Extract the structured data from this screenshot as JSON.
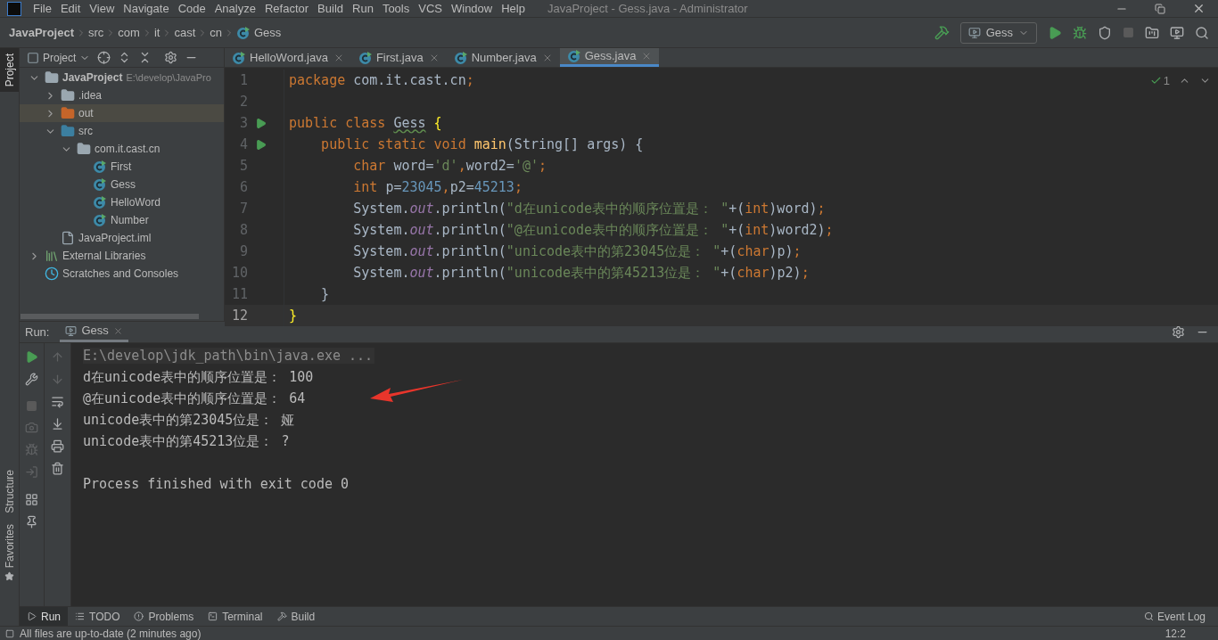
{
  "menu": [
    "File",
    "Edit",
    "View",
    "Navigate",
    "Code",
    "Analyze",
    "Refactor",
    "Build",
    "Run",
    "Tools",
    "VCS",
    "Window",
    "Help"
  ],
  "window": {
    "title": "JavaProject - Gess.java - Administrator"
  },
  "breadcrumb": [
    {
      "label": "JavaProject",
      "kind": "project"
    },
    {
      "label": "src",
      "kind": "dir"
    },
    {
      "label": "com",
      "kind": "dir"
    },
    {
      "label": "it",
      "kind": "dir"
    },
    {
      "label": "cast",
      "kind": "dir"
    },
    {
      "label": "cn",
      "kind": "dir"
    },
    {
      "label": "Gess",
      "kind": "class"
    }
  ],
  "run_config": "Gess",
  "side_tools": {
    "top": "Project",
    "structure": "Structure",
    "favorites": "Favorites"
  },
  "project_panel": {
    "title": "Project",
    "tree": [
      {
        "label": "JavaProject",
        "path": "E:\\develop\\JavaPro",
        "kind": "module",
        "expanded": true,
        "selected": false,
        "children": [
          {
            "label": ".idea",
            "kind": "folder",
            "expanded": false,
            "selected": false
          },
          {
            "label": "out",
            "kind": "output-folder",
            "expanded": false,
            "selected": true
          },
          {
            "label": "src",
            "kind": "source-folder",
            "expanded": true,
            "selected": false,
            "children": [
              {
                "label": "com.it.cast.cn",
                "kind": "package",
                "expanded": true,
                "selected": false,
                "children": [
                  {
                    "label": "First",
                    "kind": "class",
                    "selected": false
                  },
                  {
                    "label": "Gess",
                    "kind": "class",
                    "selected": false
                  },
                  {
                    "label": "HelloWord",
                    "kind": "class",
                    "selected": false
                  },
                  {
                    "label": "Number",
                    "kind": "class",
                    "selected": false
                  }
                ]
              }
            ]
          },
          {
            "label": "JavaProject.iml",
            "kind": "file",
            "selected": false
          }
        ]
      },
      {
        "label": "External Libraries",
        "kind": "libraries",
        "expanded": false,
        "selected": false
      },
      {
        "label": "Scratches and Consoles",
        "kind": "scratches",
        "selected": false
      }
    ]
  },
  "editor_tabs": [
    {
      "label": "HelloWord.java",
      "selected": false
    },
    {
      "label": "First.java",
      "selected": false
    },
    {
      "label": "Number.java",
      "selected": false
    },
    {
      "label": "Gess.java",
      "selected": true
    }
  ],
  "inspection": {
    "count": "1"
  },
  "code": [
    {
      "number": "1",
      "current": false,
      "runnable": false,
      "tokens": [
        {
          "kind": "kw",
          "text": "package"
        },
        {
          "kind": "plain",
          "text": " com.it.cast.cn"
        },
        {
          "kind": "kw",
          "text": ";"
        }
      ]
    },
    {
      "number": "2",
      "current": false,
      "runnable": false
    },
    {
      "number": "3",
      "current": false,
      "runnable": true,
      "tokens": [
        {
          "kind": "kw",
          "text": "public class "
        },
        {
          "kind": "warn",
          "text": "Gess"
        },
        {
          "kind": "brace",
          "text": " {"
        }
      ]
    },
    {
      "number": "4",
      "current": false,
      "runnable": true,
      "tokens": [
        {
          "kind": "kw",
          "text": "    public static void "
        },
        {
          "kind": "method",
          "text": "main"
        },
        {
          "kind": "plain",
          "text": "(String[] args) {"
        }
      ]
    },
    {
      "number": "5",
      "current": false,
      "runnable": false,
      "tokens": [
        {
          "kind": "kw",
          "text": "        char "
        },
        {
          "kind": "plain",
          "text": "word="
        },
        {
          "kind": "str",
          "text": "'d'"
        },
        {
          "kind": "kw",
          "text": ","
        },
        {
          "kind": "plain",
          "text": "word2="
        },
        {
          "kind": "str",
          "text": "'@'"
        },
        {
          "kind": "kw",
          "text": ";"
        }
      ]
    },
    {
      "number": "6",
      "current": false,
      "runnable": false,
      "tokens": [
        {
          "kind": "kw",
          "text": "        int "
        },
        {
          "kind": "plain",
          "text": "p="
        },
        {
          "kind": "num",
          "text": "23045"
        },
        {
          "kind": "kw",
          "text": ","
        },
        {
          "kind": "plain",
          "text": "p2="
        },
        {
          "kind": "num",
          "text": "45213"
        },
        {
          "kind": "kw",
          "text": ";"
        }
      ]
    },
    {
      "number": "7",
      "current": false,
      "runnable": false,
      "tokens": [
        {
          "kind": "plain",
          "text": "        System."
        },
        {
          "kind": "field",
          "text": "out"
        },
        {
          "kind": "plain",
          "text": ".println("
        },
        {
          "kind": "str",
          "text": "\"d在unicode表中的顺序位置是： \""
        },
        {
          "kind": "plain",
          "text": "+("
        },
        {
          "kind": "kw",
          "text": "int"
        },
        {
          "kind": "plain",
          "text": ")word)"
        },
        {
          "kind": "kw",
          "text": ";"
        }
      ]
    },
    {
      "number": "8",
      "current": false,
      "runnable": false,
      "tokens": [
        {
          "kind": "plain",
          "text": "        System."
        },
        {
          "kind": "field",
          "text": "out"
        },
        {
          "kind": "plain",
          "text": ".println("
        },
        {
          "kind": "str",
          "text": "\"@在unicode表中的顺序位置是： \""
        },
        {
          "kind": "plain",
          "text": "+("
        },
        {
          "kind": "kw",
          "text": "int"
        },
        {
          "kind": "plain",
          "text": ")word2)"
        },
        {
          "kind": "kw",
          "text": ";"
        }
      ]
    },
    {
      "number": "9",
      "current": false,
      "runnable": false,
      "tokens": [
        {
          "kind": "plain",
          "text": "        System."
        },
        {
          "kind": "field",
          "text": "out"
        },
        {
          "kind": "plain",
          "text": ".println("
        },
        {
          "kind": "str",
          "text": "\"unicode表中的第23045位是： \""
        },
        {
          "kind": "plain",
          "text": "+("
        },
        {
          "kind": "kw",
          "text": "char"
        },
        {
          "kind": "plain",
          "text": ")p)"
        },
        {
          "kind": "kw",
          "text": ";"
        }
      ]
    },
    {
      "number": "10",
      "current": false,
      "runnable": false,
      "tokens": [
        {
          "kind": "plain",
          "text": "        System."
        },
        {
          "kind": "field",
          "text": "out"
        },
        {
          "kind": "plain",
          "text": ".println("
        },
        {
          "kind": "str",
          "text": "\"unicode表中的第45213位是： \""
        },
        {
          "kind": "plain",
          "text": "+("
        },
        {
          "kind": "kw",
          "text": "char"
        },
        {
          "kind": "plain",
          "text": ")p2)"
        },
        {
          "kind": "kw",
          "text": ";"
        }
      ]
    },
    {
      "number": "11",
      "current": false,
      "runnable": false,
      "tokens": [
        {
          "kind": "plain",
          "text": "    }"
        }
      ]
    },
    {
      "number": "12",
      "current": true,
      "runnable": false,
      "tokens": [
        {
          "kind": "brace",
          "text": "}"
        }
      ]
    }
  ],
  "run_panel": {
    "label": "Run:",
    "tab": "Gess",
    "console": [
      {
        "kind": "command",
        "text": "E:\\develop\\jdk_path\\bin\\java.exe ..."
      },
      {
        "kind": "output",
        "text": "d在unicode表中的顺序位置是： 100"
      },
      {
        "kind": "output",
        "text": "@在unicode表中的顺序位置是： 64"
      },
      {
        "kind": "output",
        "text": "unicode表中的第23045位是： 娅"
      },
      {
        "kind": "output",
        "text": "unicode表中的第45213位是： ?"
      },
      {
        "kind": "status",
        "text": "Process finished with exit code 0"
      }
    ]
  },
  "tool_tabs": [
    {
      "label": "Run",
      "kind": "run",
      "selected": true
    },
    {
      "label": "TODO",
      "kind": "todo",
      "selected": false
    },
    {
      "label": "Problems",
      "kind": "problems",
      "selected": false
    },
    {
      "label": "Terminal",
      "kind": "terminal",
      "selected": false
    },
    {
      "label": "Build",
      "kind": "build",
      "selected": false
    }
  ],
  "event_log": "Event Log",
  "status_bar": {
    "message": "All files are up-to-date (2 minutes ago)",
    "position": "12:2"
  }
}
